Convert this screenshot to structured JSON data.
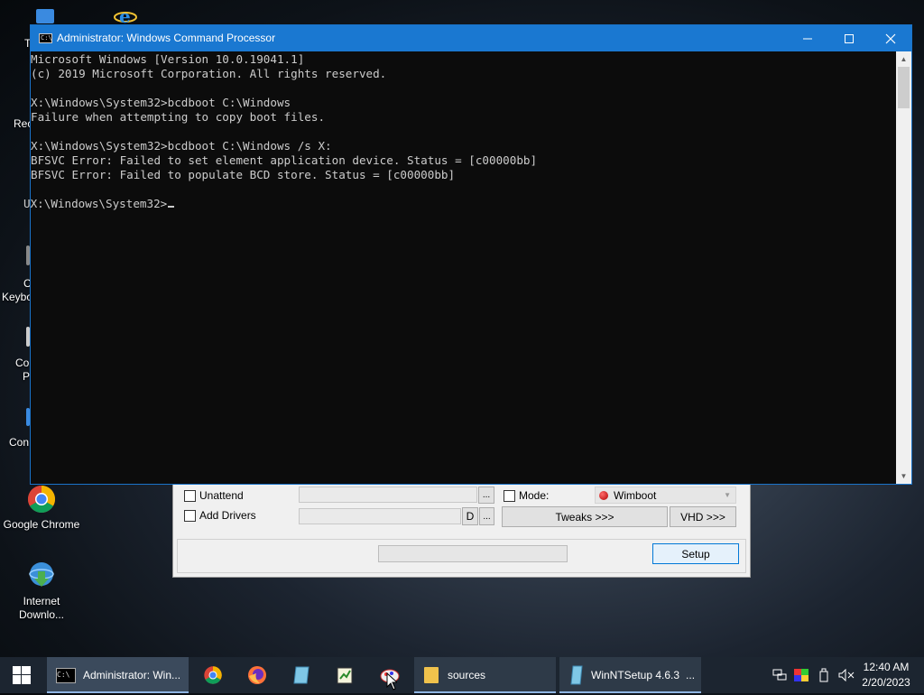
{
  "desktop": {
    "icons": [
      {
        "label": "Google Chrome"
      },
      {
        "label": "Internet\nDownlo..."
      }
    ],
    "partial_labels": [
      "T",
      "Rec",
      "C",
      "Keybo",
      "Co",
      "P",
      "Con"
    ]
  },
  "cmd": {
    "title": "Administrator: Windows Command Processor",
    "lines": [
      "Microsoft Windows [Version 10.0.19041.1]",
      "(c) 2019 Microsoft Corporation. All rights reserved.",
      "",
      "X:\\Windows\\System32>bcdboot C:\\Windows",
      "Failure when attempting to copy boot files.",
      "",
      "X:\\Windows\\System32>bcdboot C:\\Windows /s X:",
      "BFSVC Error: Failed to set element application device. Status = [c00000bb]",
      "BFSVC Error: Failed to populate BCD store. Status = [c00000bb]",
      ""
    ],
    "prompt_prefix": "U",
    "prompt": "X:\\Windows\\System32>"
  },
  "ntsetup": {
    "unattend_label": "Unattend",
    "add_drivers_label": "Add Drivers",
    "mode_label": "Mode:",
    "mode_value": "Wimboot",
    "d_label": "D",
    "ellipsis": "...",
    "tweaks_label": "Tweaks >>>",
    "vhd_label": "VHD >>>",
    "setup_label": "Setup"
  },
  "taskbar": {
    "active_item": "Administrator: Win...",
    "sources_item": "sources",
    "winnt_item": "WinNTSetup 4.6.3",
    "winnt_more": "...",
    "time": "12:40 AM",
    "date": "2/20/2023"
  },
  "colors": {
    "titlebar": "#1a78d1",
    "console_bg": "#0c0c0c",
    "console_text": "#cccccc",
    "taskbar": "#1c2530"
  }
}
